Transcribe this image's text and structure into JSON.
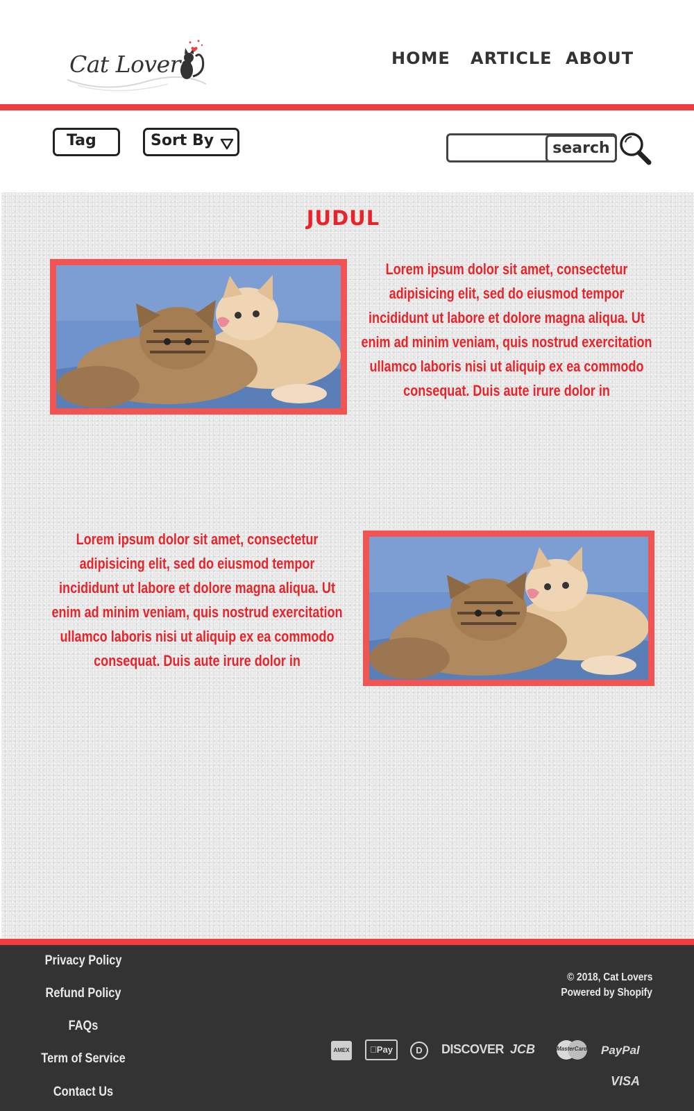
{
  "header": {
    "logo_text": "Cat Lovers",
    "nav": {
      "home": "HOME",
      "article": "ARTICLE",
      "about": "ABOUT"
    }
  },
  "toolbar": {
    "tag_label": "Tag",
    "sort_label": "Sort By",
    "search_value": "",
    "search_button_label": "search"
  },
  "main": {
    "title": "JUDUL",
    "articles": [
      {
        "text": "Lorem ipsum dolor sit amet, consectetur adipisicing elit, sed do eiusmod tempor incididunt ut labore et dolore magna aliqua. Ut enim ad minim veniam, quis nostrud exercitation ullamco laboris nisi ut aliquip ex ea commodo consequat. Duis aute irure dolor in"
      },
      {
        "text": "Lorem ipsum dolor sit amet, consectetur adipisicing elit, sed do eiusmod tempor incididunt ut labore et dolore magna aliqua. Ut enim ad minim veniam, quis nostrud exercitation ullamco laboris nisi ut aliquip ex ea commodo consequat. Duis aute irure dolor in"
      }
    ]
  },
  "footer": {
    "links": [
      "Privacy Policy",
      "Refund Policy",
      "FAQs",
      "Term of Service",
      "Contact Us"
    ],
    "copyright": "© 2018, Cat Lovers",
    "powered_by": "Powered by Shopify",
    "payments": {
      "amex": "AMEX",
      "applepay": "Pay",
      "diners": "D",
      "discover": "DISCOVER",
      "jcb": "JCB",
      "mastercard": "MasterCard",
      "paypal": "PayPal",
      "visa": "VISA"
    }
  },
  "colors": {
    "accent_red": "#f03c3c",
    "text_red": "#e8242a",
    "footer_bg": "#333333"
  }
}
